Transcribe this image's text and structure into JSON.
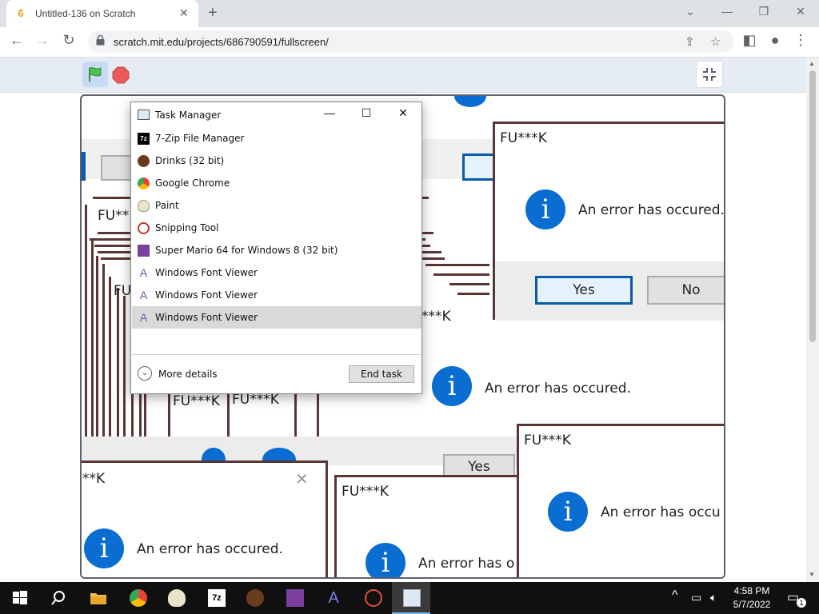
{
  "browser": {
    "tab_title": "Untitled-136 on Scratch",
    "tab_icon": "scratch-favicon",
    "url": "scratch.mit.edu/projects/686790591/fullscreen/",
    "controls": {
      "minimize": "minimize-icon",
      "restore": "restore-icon",
      "close": "close-icon"
    }
  },
  "scratch": {
    "green_flag": "green-flag-icon",
    "stop": "stop-icon",
    "exit_fullscreen": "exit-fullscreen-icon"
  },
  "stage": {
    "dialog_title": "FU***K",
    "dialog_title_partial_a": "FU**",
    "dialog_title_partial_b": "FU",
    "dialog_title_partial_c": "**K",
    "dialog_title_partial_d": "J***K",
    "error_message": "An error has occured.",
    "error_message_partial_a": "An error has occu",
    "error_message_partial_b": "An error has o",
    "yes_label": "Yes",
    "no_label": "No",
    "info_glyph": "i"
  },
  "task_manager": {
    "title": "Task Manager",
    "rows": [
      {
        "label": "7-Zip File Manager",
        "icon": "7zip-icon"
      },
      {
        "label": "Drinks (32 bit)",
        "icon": "coffee-bean-icon"
      },
      {
        "label": "Google Chrome",
        "icon": "chrome-icon"
      },
      {
        "label": "Paint",
        "icon": "paint-icon"
      },
      {
        "label": "Snipping Tool",
        "icon": "snipping-tool-icon"
      },
      {
        "label": "Super Mario 64 for Windows 8 (32 bit)",
        "icon": "mario-icon"
      },
      {
        "label": "Windows Font Viewer",
        "icon": "font-viewer-icon"
      },
      {
        "label": "Windows Font Viewer",
        "icon": "font-viewer-icon"
      },
      {
        "label": "Windows Font Viewer",
        "icon": "font-viewer-icon",
        "selected": true
      }
    ],
    "more_details": "More details",
    "end_task": "End task"
  },
  "taskbar": {
    "time": "4:58 PM",
    "date": "5/7/2022",
    "notification_count": "1",
    "apps": [
      "start",
      "search",
      "file-explorer",
      "chrome",
      "paint",
      "7zip",
      "drinks",
      "mario",
      "font-viewer",
      "snipping-tool",
      "task-manager"
    ]
  },
  "colors": {
    "dialog_border": "#5a3535",
    "info_blue": "#0a6dd1",
    "button_focus": "#0a5bab",
    "taskbar_bg": "#101010"
  }
}
